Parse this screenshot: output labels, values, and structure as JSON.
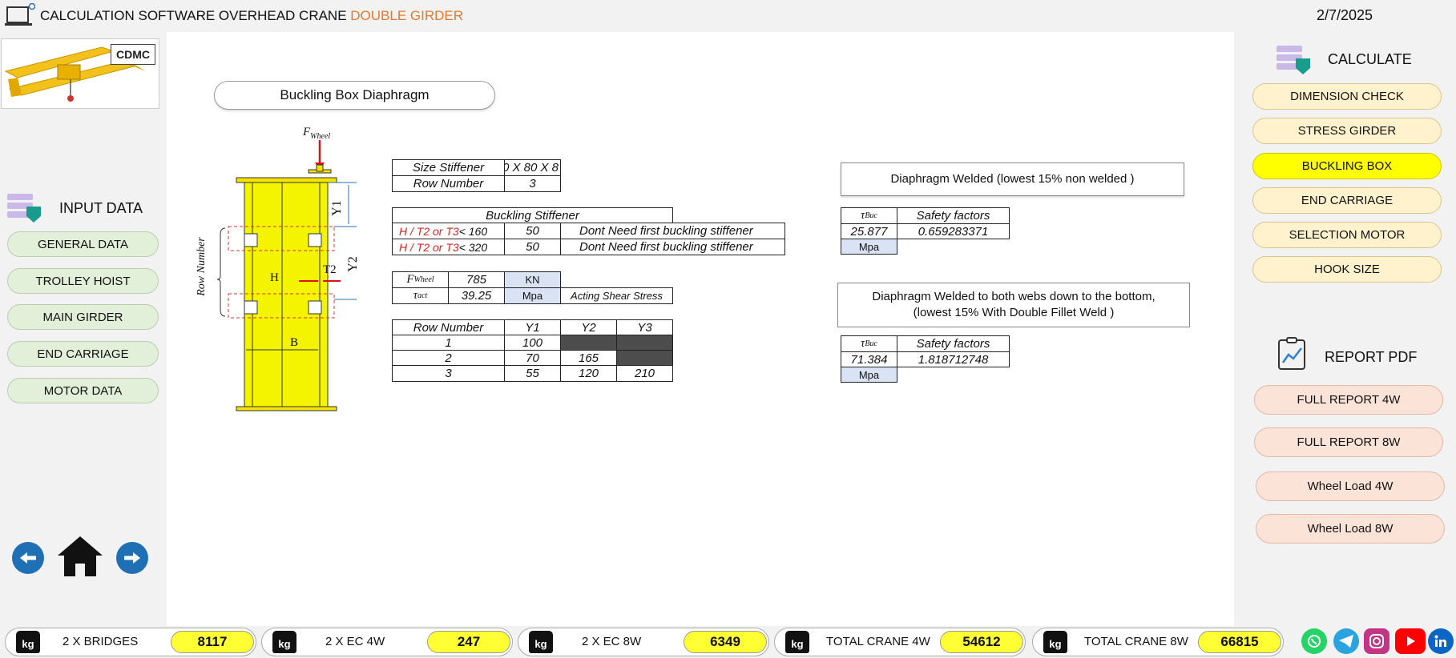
{
  "header": {
    "title_main": "CALCULATION SOFTWARE OVERHEAD CRANE ",
    "title_accent": "DOUBLE GIRDER",
    "date": "2/7/2025"
  },
  "logo": {
    "brand": "CDMC"
  },
  "left_panel": {
    "title": "INPUT DATA",
    "buttons": [
      "GENERAL DATA",
      "TROLLEY HOIST",
      "MAIN GIRDER",
      "END CARRIAGE",
      "MOTOR DATA"
    ]
  },
  "right_panel": {
    "calculate_title": "CALCULATE",
    "calculate_buttons": [
      "DIMENSION CHECK",
      "STRESS GIRDER",
      "BUCKLING BOX",
      "END CARRIAGE",
      "SELECTION MOTOR",
      "HOOK SIZE"
    ],
    "active_button": "BUCKLING BOX",
    "report_title": "REPORT PDF",
    "report_buttons": [
      "FULL REPORT 4W",
      "FULL REPORT 8W",
      "Wheel Load 4W",
      "Wheel Load  8W"
    ]
  },
  "section_title": "Buckling Box Diaphragm",
  "diagram": {
    "force_label": "F",
    "force_sub": "Wheel",
    "y1": "Y1",
    "y2": "Y2",
    "t2": "T2",
    "h": "H",
    "b": "B",
    "row_number": "Row Number"
  },
  "stiffener": {
    "size_label": "Size Stiffener",
    "size_value": "0 X 80 X 8",
    "row_label": "Row Number",
    "row_value": "3"
  },
  "buckling_stiffener": {
    "title": "Buckling Stiffener",
    "rows": [
      {
        "cond_red": "H / T2 or T3",
        "cond_rest": " < 160",
        "value": "50",
        "result": "Dont Need first buckling stiffener"
      },
      {
        "cond_red": "H / T2 or T3",
        "cond_rest": " < 320",
        "value": "50",
        "result": "Dont Need first buckling stiffener"
      }
    ]
  },
  "forces": {
    "f_wheel_label": "F",
    "f_wheel_sub": "Wheel",
    "f_wheel_value": "785",
    "f_wheel_unit": "KN",
    "tau_act_label": "τ",
    "tau_act_sub": "act",
    "tau_act_value": "39.25",
    "tau_act_unit": "Mpa",
    "tau_act_note": "Acting Shear Stress"
  },
  "rows_table": {
    "headers": [
      "Row Number",
      "Y1",
      "Y2",
      "Y3"
    ],
    "rows": [
      [
        "1",
        "100",
        "",
        ""
      ],
      [
        "2",
        "70",
        "165",
        ""
      ],
      [
        "3",
        "55",
        "120",
        "210"
      ]
    ]
  },
  "diaphragm_1": {
    "title": "Diaphragm Welded  (lowest 15% non welded )",
    "tau_label": "τ",
    "tau_sub": "Buc",
    "sf_label": "Safety factors",
    "tau_value": "25.877",
    "sf_value": "0.659283371",
    "unit": "Mpa"
  },
  "diaphragm_2": {
    "title_line1": "Diaphragm Welded to both webs down to the bottom,",
    "title_line2": "(lowest 15% With Double Fillet Weld )",
    "tau_label": "τ",
    "tau_sub": "Buc",
    "sf_label": "Safety factors",
    "tau_value": "71.384",
    "sf_value": "1.818712748",
    "unit": "Mpa"
  },
  "weights": [
    {
      "icon": "kg",
      "label": "2 X BRIDGES",
      "value": "8117"
    },
    {
      "icon": "kg",
      "label": "2 X EC 4W",
      "value": "247"
    },
    {
      "icon": "kg",
      "label": "2 X EC 8W",
      "value": "6349"
    },
    {
      "icon": "kg",
      "label": "TOTAL CRANE 4W",
      "value": "54612"
    },
    {
      "icon": "kg",
      "label": "TOTAL CRANE 8W",
      "value": "66815"
    }
  ],
  "social": [
    "whatsapp-icon",
    "telegram-icon",
    "instagram-icon",
    "youtube-icon",
    "linkedin-icon"
  ],
  "colors": {
    "accent_orange": "#e07a2f",
    "highlight_yellow": "#ffff33",
    "left_button_green": "#e2efd9",
    "right_button_cream": "#fff2cc",
    "report_button_peach": "#fbe3d8",
    "nav_blue": "#1f6fb5"
  }
}
